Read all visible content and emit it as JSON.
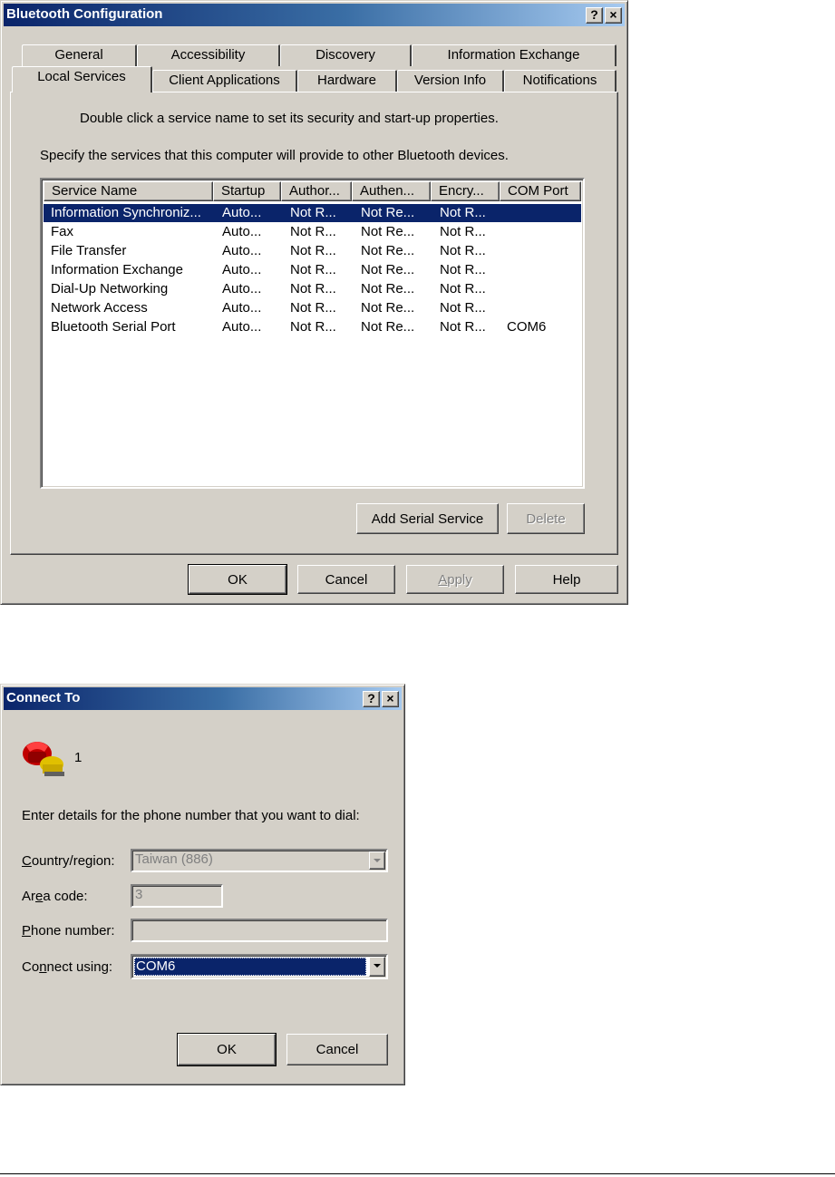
{
  "bluetooth_window": {
    "title": "Bluetooth Configuration",
    "help_button": "?",
    "close_button": "×",
    "tabs_back": [
      "General",
      "Accessibility",
      "Discovery",
      "Information Exchange"
    ],
    "tabs_front": [
      "Local Services",
      "Client Applications",
      "Hardware",
      "Version Info",
      "Notifications"
    ],
    "active_tab": "Local Services",
    "instruction": "Double click a service name to set its security and start-up properties.",
    "description": "Specify the services that this computer will provide to other Bluetooth devices.",
    "columns": [
      "Service Name",
      "Startup",
      "Author...",
      "Authen...",
      "Encry...",
      "COM Port"
    ],
    "rows": [
      [
        "Information Synchroniz...",
        "Auto...",
        "Not R...",
        "Not Re...",
        "Not R...",
        ""
      ],
      [
        "Fax",
        "Auto...",
        "Not R...",
        "Not Re...",
        "Not R...",
        ""
      ],
      [
        "File Transfer",
        "Auto...",
        "Not R...",
        "Not Re...",
        "Not R...",
        ""
      ],
      [
        "Information Exchange",
        "Auto...",
        "Not R...",
        "Not Re...",
        "Not R...",
        ""
      ],
      [
        "Dial-Up Networking",
        "Auto...",
        "Not R...",
        "Not Re...",
        "Not R...",
        ""
      ],
      [
        "Network Access",
        "Auto...",
        "Not R...",
        "Not Re...",
        "Not R...",
        ""
      ],
      [
        "Bluetooth Serial Port",
        "Auto...",
        "Not R...",
        "Not Re...",
        "Not R...",
        "COM6"
      ]
    ],
    "selected_row": 0,
    "add_serial_label": "Add Serial Service",
    "delete_label": "Delete",
    "ok_label": "OK",
    "cancel_label": "Cancel",
    "apply_label": "Apply",
    "help_label": "Help"
  },
  "connect_window": {
    "title": "Connect To",
    "help_button": "?",
    "close_button": "×",
    "connection_name": "1",
    "prompt": "Enter details for the phone number that you want to dial:",
    "country_label": "Country/region:",
    "country_value": "Taiwan (886)",
    "area_label": "Area code:",
    "area_value": "3",
    "phone_label": "Phone number:",
    "phone_value": "",
    "connect_label": "Connect using:",
    "connect_value": "COM6",
    "ok_label": "OK",
    "cancel_label": "Cancel"
  },
  "colors": {
    "title_bar": "#0a246a",
    "face": "#d4d0c8",
    "selection": "#0a246a"
  },
  "icons": [
    "phone-connection-icon",
    "help-icon",
    "close-icon",
    "dropdown-arrow-icon"
  ]
}
